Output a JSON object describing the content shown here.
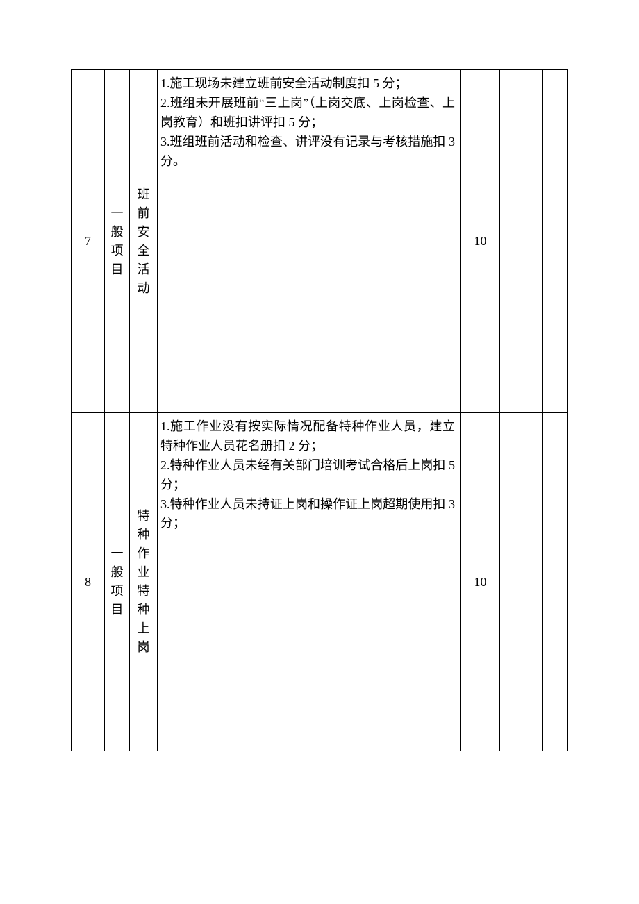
{
  "rows": [
    {
      "num": "7",
      "category": "一般项目",
      "subject": "班前安全活动",
      "content": "1.施工现场未建立班前安全活动制度扣 5 分；\n2.班组未开展班前“三上岗”（上岗交底、上岗检查、上岗教育）和班扣讲评扣 5 分；\n3.班组班前活动和检查、讲评没有记录与考核措施扣 3 分。",
      "score": "10",
      "extra1": "",
      "extra2": ""
    },
    {
      "num": "8",
      "category": "一般项目",
      "subject": "特种作业特种上岗",
      "content": "1.施工作业没有按实际情况配备特种作业人员，建立特种作业人员花名册扣 2 分；\n2.特种作业人员未经有关部门培训考试合格后上岗扣 5 分；\n3.特种作业人员未持证上岗和操作证上岗超期使用扣 3 分；",
      "score": "10",
      "extra1": "",
      "extra2": ""
    }
  ]
}
